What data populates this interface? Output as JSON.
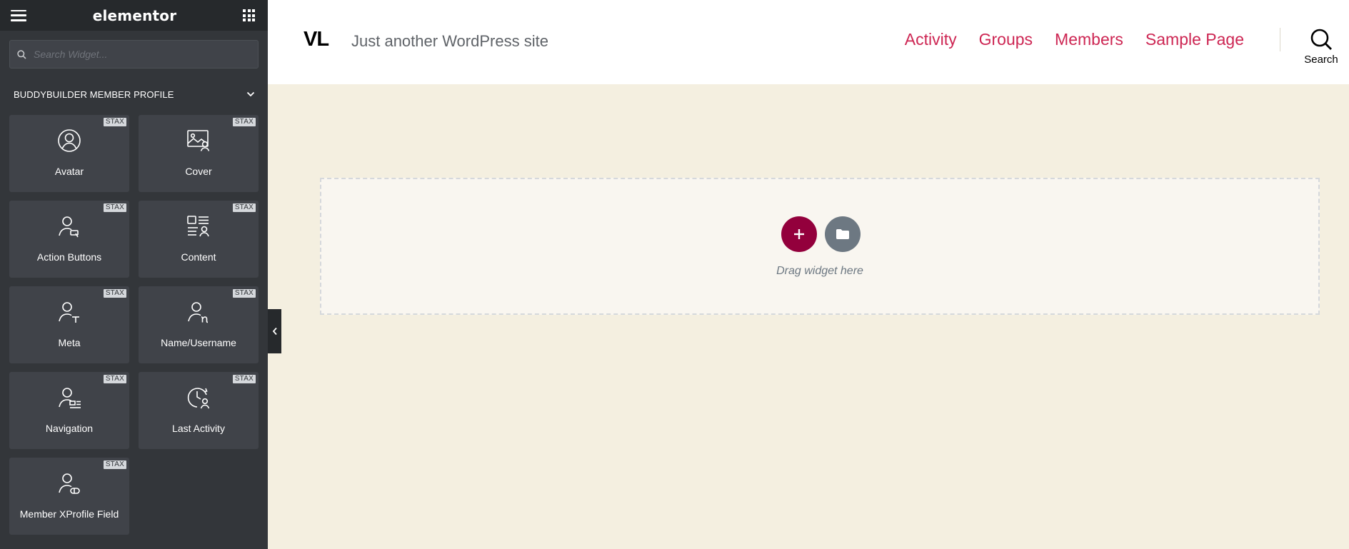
{
  "panel": {
    "brand": "elementor",
    "search_placeholder": "Search Widget...",
    "category": "BUDDYBUILDER MEMBER PROFILE",
    "badge_text": "STAX",
    "widgets": [
      {
        "label": "Avatar",
        "icon": "user-circle-icon"
      },
      {
        "label": "Cover",
        "icon": "image-user-icon"
      },
      {
        "label": "Action Buttons",
        "icon": "user-action-icon"
      },
      {
        "label": "Content",
        "icon": "content-list-icon"
      },
      {
        "label": "Meta",
        "icon": "user-meta-icon"
      },
      {
        "label": "Name/Username",
        "icon": "user-name-icon"
      },
      {
        "label": "Navigation",
        "icon": "user-navigation-icon"
      },
      {
        "label": "Last Activity",
        "icon": "clock-user-icon"
      },
      {
        "label": "Member XProfile Field",
        "icon": "user-field-icon"
      }
    ]
  },
  "site": {
    "logo": "VL",
    "tagline": "Just another WordPress site",
    "nav": [
      "Activity",
      "Groups",
      "Members",
      "Sample Page"
    ],
    "search_label": "Search"
  },
  "canvas": {
    "drop_hint": "Drag widget here"
  },
  "colors": {
    "panel_bg": "#33363a",
    "widget_bg": "#404349",
    "nav_link": "#cd2653",
    "add_button": "#93003c",
    "library_button": "#6d7882",
    "page_bg": "#f4efe0"
  }
}
